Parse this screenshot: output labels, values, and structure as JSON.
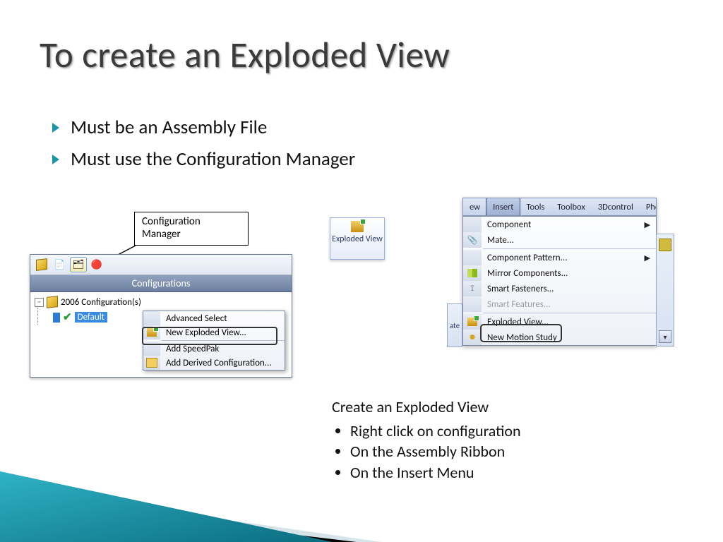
{
  "title": "To create an Exploded View",
  "bullets": [
    "Must be an Assembly File",
    "Must use the Configuration Manager"
  ],
  "callout_label": "Configuration Manager",
  "panel": {
    "header": "Configurations",
    "root_label": "2006 Configuration(s)",
    "child_label": "Default"
  },
  "context_menu": {
    "items": [
      "Advanced Select",
      "New Exploded View...",
      "Add SpeedPak",
      "Add Derived Configuration..."
    ]
  },
  "ribbon_button": "Exploded View",
  "menubar": {
    "items": [
      "ew",
      "Insert",
      "Tools",
      "Toolbox",
      "3Dcontrol",
      "Pho"
    ]
  },
  "insert_menu": {
    "items": [
      {
        "label": "Component",
        "submenu": true
      },
      {
        "label": "Mate..."
      },
      {
        "label": "Component Pattern...",
        "submenu": true
      },
      {
        "label": "Mirror Components..."
      },
      {
        "label": "Smart Fasteners..."
      },
      {
        "label": "Smart Features...",
        "disabled": true
      },
      {
        "label": "Exploded View..."
      },
      {
        "label": "New Motion Study"
      }
    ]
  },
  "left_strip": "ate",
  "instructions": {
    "heading": "Create an Exploded View",
    "items": [
      "Right click on configuration",
      "On the Assembly Ribbon",
      "On the Insert Menu"
    ]
  }
}
